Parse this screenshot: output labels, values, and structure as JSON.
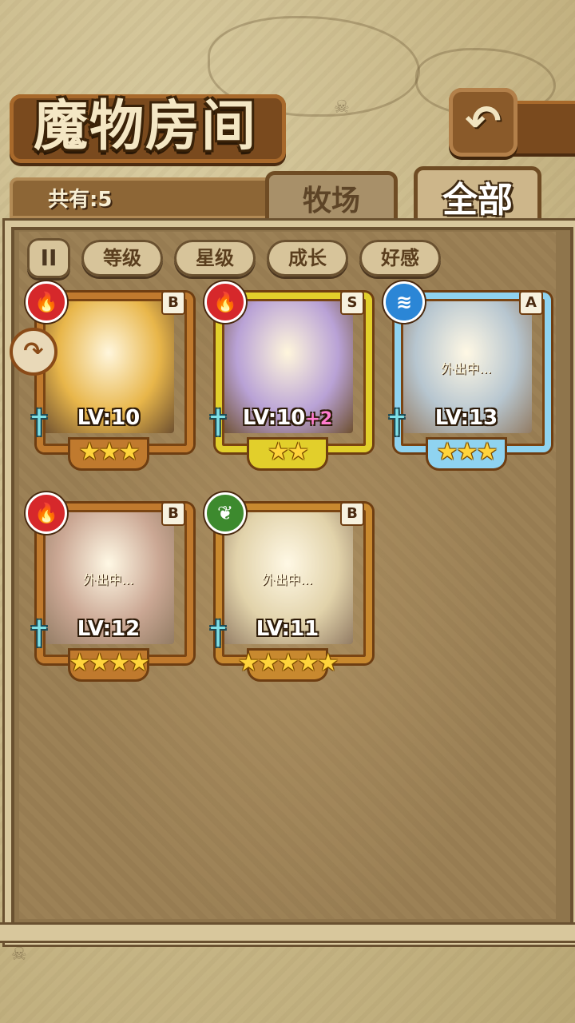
{
  "header": {
    "title": "魔物房间",
    "back_icon": "↶"
  },
  "summary": {
    "count_text": "共有:5"
  },
  "tabs": [
    {
      "label": "牧场",
      "selected": false
    },
    {
      "label": "全部",
      "selected": true
    }
  ],
  "sort_bar": {
    "pause_icon": "II",
    "buttons": [
      "等级",
      "星级",
      "成长",
      "好感"
    ]
  },
  "side_badge_icon": "↷",
  "cards": [
    {
      "element": "fire",
      "element_icon": "🔥",
      "rank": "B",
      "level": "LV:10",
      "bonus": "",
      "stars": "★★★",
      "away": "",
      "frame_color": "#c07a2e",
      "portrait_color": "#e8b64a"
    },
    {
      "element": "fire",
      "element_icon": "🔥",
      "rank": "S",
      "level": "LV:10",
      "bonus": "+2",
      "stars": "★★",
      "away": "",
      "frame_color": "#e2cf2b",
      "portrait_color": "#b9a2d6"
    },
    {
      "element": "water",
      "element_icon": "≋",
      "rank": "A",
      "level": "LV:13",
      "bonus": "",
      "stars": "★★★",
      "away": "外出中...",
      "frame_color": "#8fd3f0",
      "portrait_color": "#9fb3c0"
    },
    {
      "element": "fire",
      "element_icon": "🔥",
      "rank": "B",
      "level": "LV:12",
      "bonus": "",
      "stars": "★★★★",
      "away": "外出中...",
      "frame_color": "#c07a2e",
      "portrait_color": "#b98a70"
    },
    {
      "element": "wood",
      "element_icon": "❦",
      "rank": "B",
      "level": "LV:11",
      "bonus": "",
      "stars": "★★★★★",
      "away": "外出中...",
      "frame_color": "#c8892f",
      "portrait_color": "#d8c48e"
    }
  ]
}
